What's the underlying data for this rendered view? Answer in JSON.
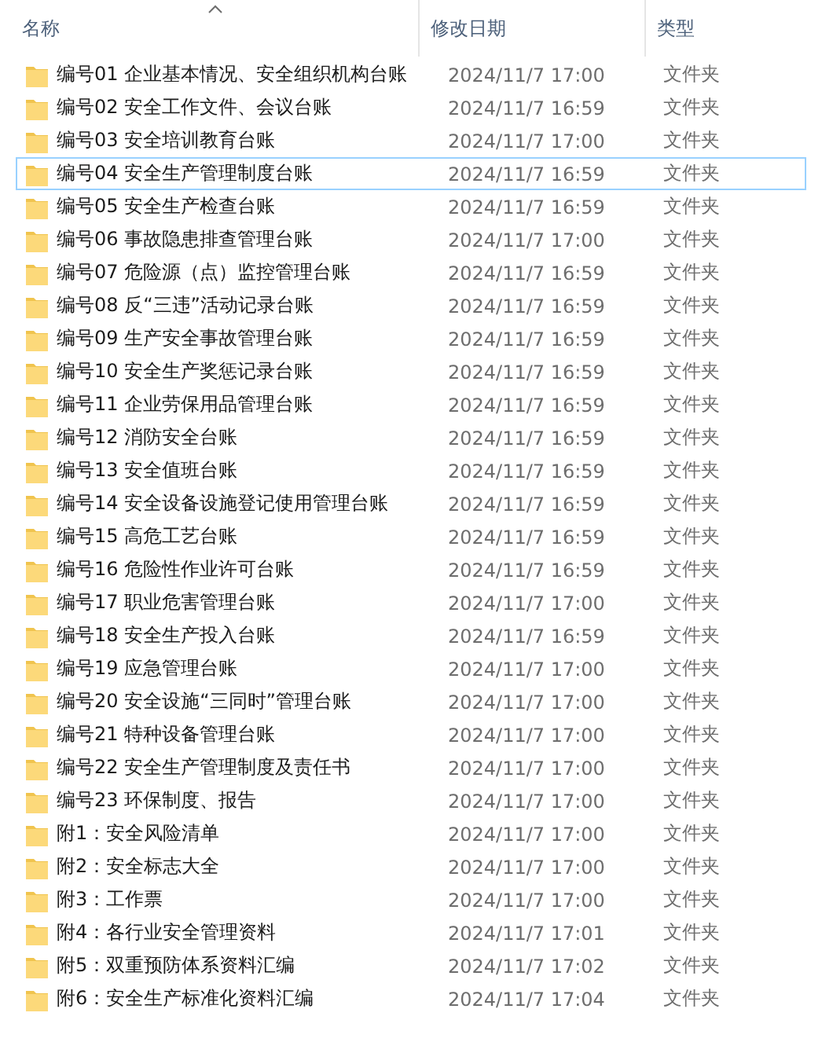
{
  "columns": [
    {
      "label": "名称",
      "sorted": true
    },
    {
      "label": "修改日期",
      "sorted": false
    },
    {
      "label": "类型",
      "sorted": false
    }
  ],
  "rows": [
    {
      "name": "编号01 企业基本情况、安全组织机构台账",
      "modified": "2024/11/7 17:00",
      "type": "文件夹",
      "focused": false
    },
    {
      "name": "编号02 安全工作文件、会议台账",
      "modified": "2024/11/7 16:59",
      "type": "文件夹",
      "focused": false
    },
    {
      "name": "编号03 安全培训教育台账",
      "modified": "2024/11/7 17:00",
      "type": "文件夹",
      "focused": false
    },
    {
      "name": "编号04 安全生产管理制度台账",
      "modified": "2024/11/7 16:59",
      "type": "文件夹",
      "focused": true
    },
    {
      "name": "编号05 安全生产检查台账",
      "modified": "2024/11/7 16:59",
      "type": "文件夹",
      "focused": false
    },
    {
      "name": "编号06 事故隐患排查管理台账",
      "modified": "2024/11/7 17:00",
      "type": "文件夹",
      "focused": false
    },
    {
      "name": "编号07 危险源（点）监控管理台账",
      "modified": "2024/11/7 16:59",
      "type": "文件夹",
      "focused": false
    },
    {
      "name": "编号08 反“三违”活动记录台账",
      "modified": "2024/11/7 16:59",
      "type": "文件夹",
      "focused": false
    },
    {
      "name": "编号09 生产安全事故管理台账",
      "modified": "2024/11/7 16:59",
      "type": "文件夹",
      "focused": false
    },
    {
      "name": "编号10 安全生产奖惩记录台账",
      "modified": "2024/11/7 16:59",
      "type": "文件夹",
      "focused": false
    },
    {
      "name": "编号11 企业劳保用品管理台账",
      "modified": "2024/11/7 16:59",
      "type": "文件夹",
      "focused": false
    },
    {
      "name": "编号12 消防安全台账",
      "modified": "2024/11/7 16:59",
      "type": "文件夹",
      "focused": false
    },
    {
      "name": "编号13 安全值班台账",
      "modified": "2024/11/7 16:59",
      "type": "文件夹",
      "focused": false
    },
    {
      "name": "编号14 安全设备设施登记使用管理台账",
      "modified": "2024/11/7 16:59",
      "type": "文件夹",
      "focused": false
    },
    {
      "name": "编号15 高危工艺台账",
      "modified": "2024/11/7 16:59",
      "type": "文件夹",
      "focused": false
    },
    {
      "name": "编号16 危险性作业许可台账",
      "modified": "2024/11/7 16:59",
      "type": "文件夹",
      "focused": false
    },
    {
      "name": "编号17 职业危害管理台账",
      "modified": "2024/11/7 17:00",
      "type": "文件夹",
      "focused": false
    },
    {
      "name": "编号18 安全生产投入台账",
      "modified": "2024/11/7 16:59",
      "type": "文件夹",
      "focused": false
    },
    {
      "name": "编号19 应急管理台账",
      "modified": "2024/11/7 17:00",
      "type": "文件夹",
      "focused": false
    },
    {
      "name": "编号20 安全设施“三同时”管理台账",
      "modified": "2024/11/7 17:00",
      "type": "文件夹",
      "focused": false
    },
    {
      "name": "编号21 特种设备管理台账",
      "modified": "2024/11/7 17:00",
      "type": "文件夹",
      "focused": false
    },
    {
      "name": "编号22 安全生产管理制度及责任书",
      "modified": "2024/11/7 17:00",
      "type": "文件夹",
      "focused": false
    },
    {
      "name": "编号23 环保制度、报告",
      "modified": "2024/11/7 17:00",
      "type": "文件夹",
      "focused": false
    },
    {
      "name": "附1：安全风险清单",
      "modified": "2024/11/7 17:00",
      "type": "文件夹",
      "focused": false
    },
    {
      "name": "附2：安全标志大全",
      "modified": "2024/11/7 17:00",
      "type": "文件夹",
      "focused": false
    },
    {
      "name": "附3：工作票",
      "modified": "2024/11/7 17:00",
      "type": "文件夹",
      "focused": false
    },
    {
      "name": "附4：各行业安全管理资料",
      "modified": "2024/11/7 17:01",
      "type": "文件夹",
      "focused": false
    },
    {
      "name": "附5：双重预防体系资料汇编",
      "modified": "2024/11/7 17:02",
      "type": "文件夹",
      "focused": false
    },
    {
      "name": "附6：安全生产标准化资料汇编",
      "modified": "2024/11/7 17:04",
      "type": "文件夹",
      "focused": false
    }
  ]
}
